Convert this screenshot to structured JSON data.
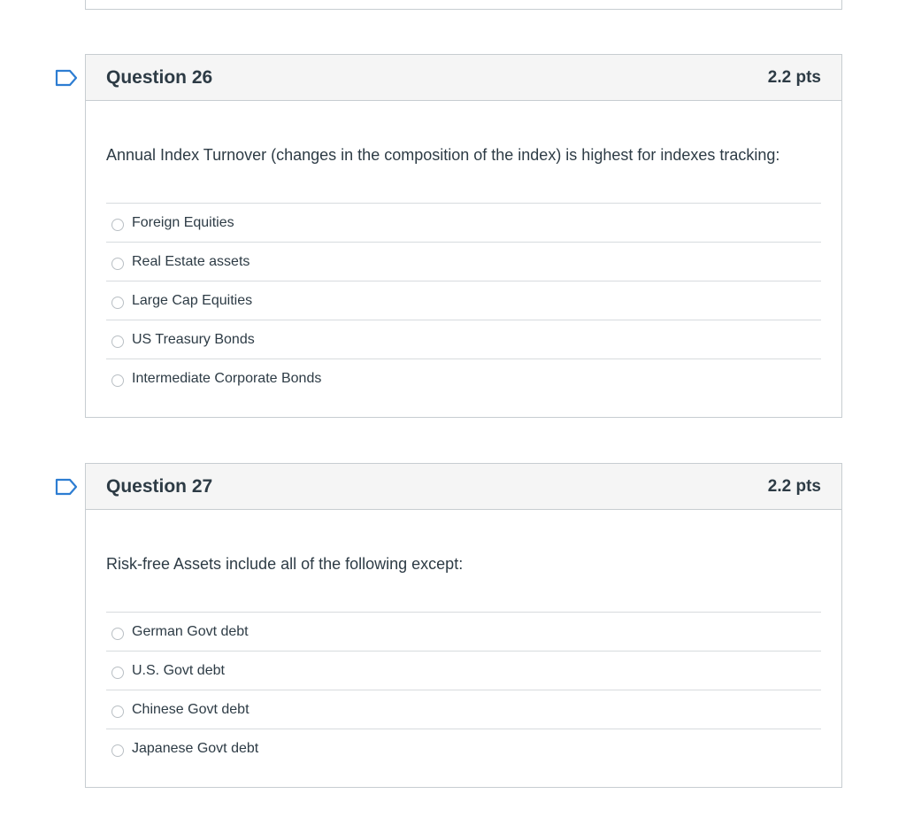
{
  "questions": [
    {
      "title": "Question 26",
      "points": "2.2 pts",
      "text": "Annual Index Turnover (changes in the composition of the index) is highest for indexes tracking:",
      "answers": [
        "Foreign Equities",
        "Real Estate assets",
        "Large Cap Equities",
        "US Treasury Bonds",
        "Intermediate Corporate Bonds"
      ]
    },
    {
      "title": "Question 27",
      "points": "2.2 pts",
      "text": "Risk-free Assets include all of the following except:",
      "answers": [
        "German Govt debt",
        "U.S. Govt debt",
        "Chinese Govt debt",
        "Japanese Govt debt"
      ]
    }
  ],
  "colors": {
    "header_bg": "#f5f5f5",
    "border": "#c7cdd1",
    "text": "#2d3b45",
    "flag": "#2d7dd2"
  },
  "icons": {
    "flag": "flag-outline-icon",
    "radio": "radio-unchecked-icon"
  }
}
